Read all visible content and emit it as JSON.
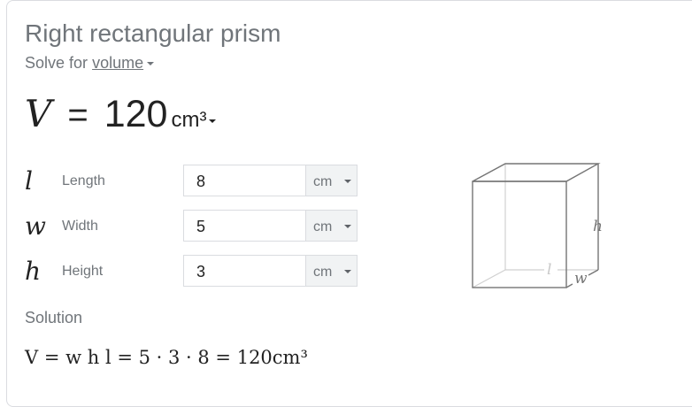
{
  "header": {
    "title": "Right rectangular prism",
    "solve_for_prefix": "Solve for",
    "solve_for_value": "volume"
  },
  "result": {
    "variable": "V",
    "equals": "=",
    "value": "120",
    "unit": "cm³"
  },
  "inputs": [
    {
      "symbol": "l",
      "label": "Length",
      "value": "8",
      "unit": "cm"
    },
    {
      "symbol": "w",
      "label": "Width",
      "value": "5",
      "unit": "cm"
    },
    {
      "symbol": "h",
      "label": "Height",
      "value": "3",
      "unit": "cm"
    }
  ],
  "solution": {
    "label": "Solution",
    "formula": "V = w h l = 5 · 3 · 8 = 120cm³"
  },
  "diagram": {
    "label_h": "h",
    "label_l": "l",
    "label_w": "w"
  },
  "colors": {
    "muted_text": "#70757a",
    "border": "#dadce0",
    "unit_bg": "#f1f3f4"
  }
}
